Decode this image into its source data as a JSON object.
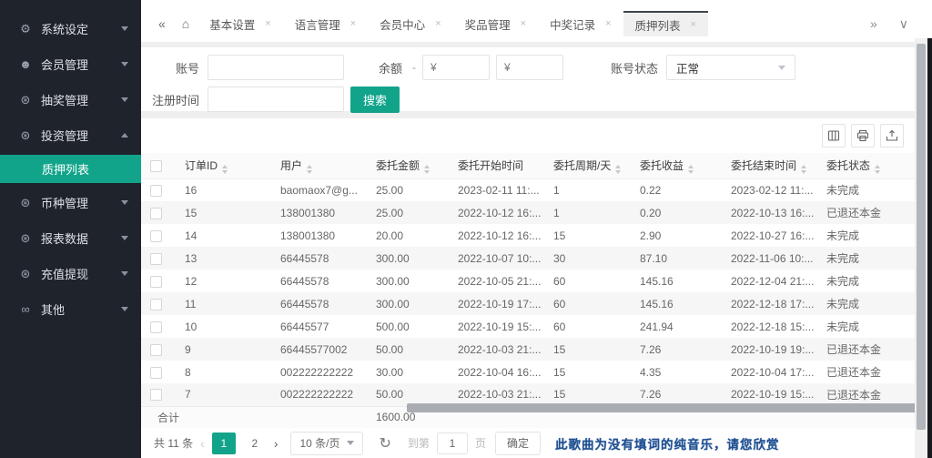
{
  "colors": {
    "accent": "#12a48b",
    "sidebar_bg": "#1f232b"
  },
  "sidebar": {
    "items": [
      {
        "label": "系统设定",
        "icon": "gear-icon",
        "glyph": "⚙",
        "expanded": false
      },
      {
        "label": "会员管理",
        "icon": "user-icon",
        "glyph": "☻",
        "expanded": false
      },
      {
        "label": "抽奖管理",
        "icon": "lottery-icon",
        "glyph": "⊛",
        "expanded": false
      },
      {
        "label": "投资管理",
        "icon": "invest-icon",
        "glyph": "⊛",
        "expanded": true,
        "children": [
          {
            "label": "质押列表",
            "active": true
          }
        ]
      },
      {
        "label": "币种管理",
        "icon": "coin-icon",
        "glyph": "⊛",
        "expanded": false
      },
      {
        "label": "报表数据",
        "icon": "report-icon",
        "glyph": "⊛",
        "expanded": false
      },
      {
        "label": "充值提现",
        "icon": "recharge-icon",
        "glyph": "⊛",
        "expanded": false
      },
      {
        "label": "其他",
        "icon": "other-icon",
        "glyph": "∞",
        "expanded": false
      }
    ]
  },
  "tab_bar": {
    "collapse_icon": "«",
    "home_icon": "⌂",
    "expand_icon": "»",
    "more_icon": "∨",
    "close_icon": "×",
    "tabs": [
      {
        "label": "基本设置",
        "active": false
      },
      {
        "label": "语言管理",
        "active": false
      },
      {
        "label": "会员中心",
        "active": false
      },
      {
        "label": "奖品管理",
        "active": false
      },
      {
        "label": "中奖记录",
        "active": false
      },
      {
        "label": "质押列表",
        "active": true
      }
    ]
  },
  "search_form": {
    "account_label": "账号",
    "balance_label": "余额",
    "balance_dash": "-",
    "balance_min_placeholder": "¥",
    "balance_max_placeholder": "¥",
    "status_label": "账号状态",
    "status_value": "正常",
    "register_label": "注册时间",
    "search_button": "搜索"
  },
  "table_toolbar": {
    "icons": [
      "columns-icon",
      "print-icon",
      "export-icon"
    ]
  },
  "table": {
    "columns": [
      {
        "label": "订单ID",
        "sortable": true
      },
      {
        "label": "用户",
        "sortable": true
      },
      {
        "label": "委托金额",
        "sortable": true
      },
      {
        "label": "委托开始时间",
        "sortable": false
      },
      {
        "label": "委托周期/天",
        "sortable": true
      },
      {
        "label": "委托收益",
        "sortable": true
      },
      {
        "label": "委托结束时间",
        "sortable": true
      },
      {
        "label": "委托状态",
        "sortable": true
      }
    ],
    "rows": [
      {
        "order_id": "16",
        "user": "baomaox7@g...",
        "amount": "25.00",
        "start_time": "2023-02-11 11:...",
        "period": "1",
        "profit": "0.22",
        "end_time": "2023-02-12 11:...",
        "status": "未完成"
      },
      {
        "order_id": "15",
        "user": "138001380",
        "amount": "25.00",
        "start_time": "2022-10-12 16:...",
        "period": "1",
        "profit": "0.20",
        "end_time": "2022-10-13 16:...",
        "status": "已退还本金"
      },
      {
        "order_id": "14",
        "user": "138001380",
        "amount": "20.00",
        "start_time": "2022-10-12 16:...",
        "period": "15",
        "profit": "2.90",
        "end_time": "2022-10-27 16:...",
        "status": "未完成"
      },
      {
        "order_id": "13",
        "user": "66445578",
        "amount": "300.00",
        "start_time": "2022-10-07 10:...",
        "period": "30",
        "profit": "87.10",
        "end_time": "2022-11-06 10:...",
        "status": "未完成"
      },
      {
        "order_id": "12",
        "user": "66445578",
        "amount": "300.00",
        "start_time": "2022-10-05 21:...",
        "period": "60",
        "profit": "145.16",
        "end_time": "2022-12-04 21:...",
        "status": "未完成"
      },
      {
        "order_id": "11",
        "user": "66445578",
        "amount": "300.00",
        "start_time": "2022-10-19 17:...",
        "period": "60",
        "profit": "145.16",
        "end_time": "2022-12-18 17:...",
        "status": "未完成"
      },
      {
        "order_id": "10",
        "user": "66445577",
        "amount": "500.00",
        "start_time": "2022-10-19 15:...",
        "period": "60",
        "profit": "241.94",
        "end_time": "2022-12-18 15:...",
        "status": "未完成"
      },
      {
        "order_id": "9",
        "user": "66445577002",
        "amount": "50.00",
        "start_time": "2022-10-03 21:...",
        "period": "15",
        "profit": "7.26",
        "end_time": "2022-10-19 19:...",
        "status": "已退还本金"
      },
      {
        "order_id": "8",
        "user": "002222222222",
        "amount": "30.00",
        "start_time": "2022-10-04 16:...",
        "period": "15",
        "profit": "4.35",
        "end_time": "2022-10-04 17:...",
        "status": "已退还本金"
      },
      {
        "order_id": "7",
        "user": "002222222222",
        "amount": "50.00",
        "start_time": "2022-10-03 21:...",
        "period": "15",
        "profit": "7.26",
        "end_time": "2022-10-19 15:...",
        "status": "已退还本金"
      }
    ],
    "total_label": "合计",
    "total_amount": "1600.00"
  },
  "pagination": {
    "total_text": "共 11 条",
    "prev_icon": "‹",
    "next_icon": "›",
    "pages": [
      {
        "label": "1",
        "active": true
      },
      {
        "label": "2",
        "active": false
      }
    ],
    "page_size": "10 条/页",
    "refresh_icon": "↻",
    "goto_label": "到第",
    "goto_value": "1",
    "page_word": "页",
    "confirm_button": "确定"
  },
  "overlay": {
    "lyric_text": "此歌曲为没有填词的纯音乐，请您欣赏"
  }
}
